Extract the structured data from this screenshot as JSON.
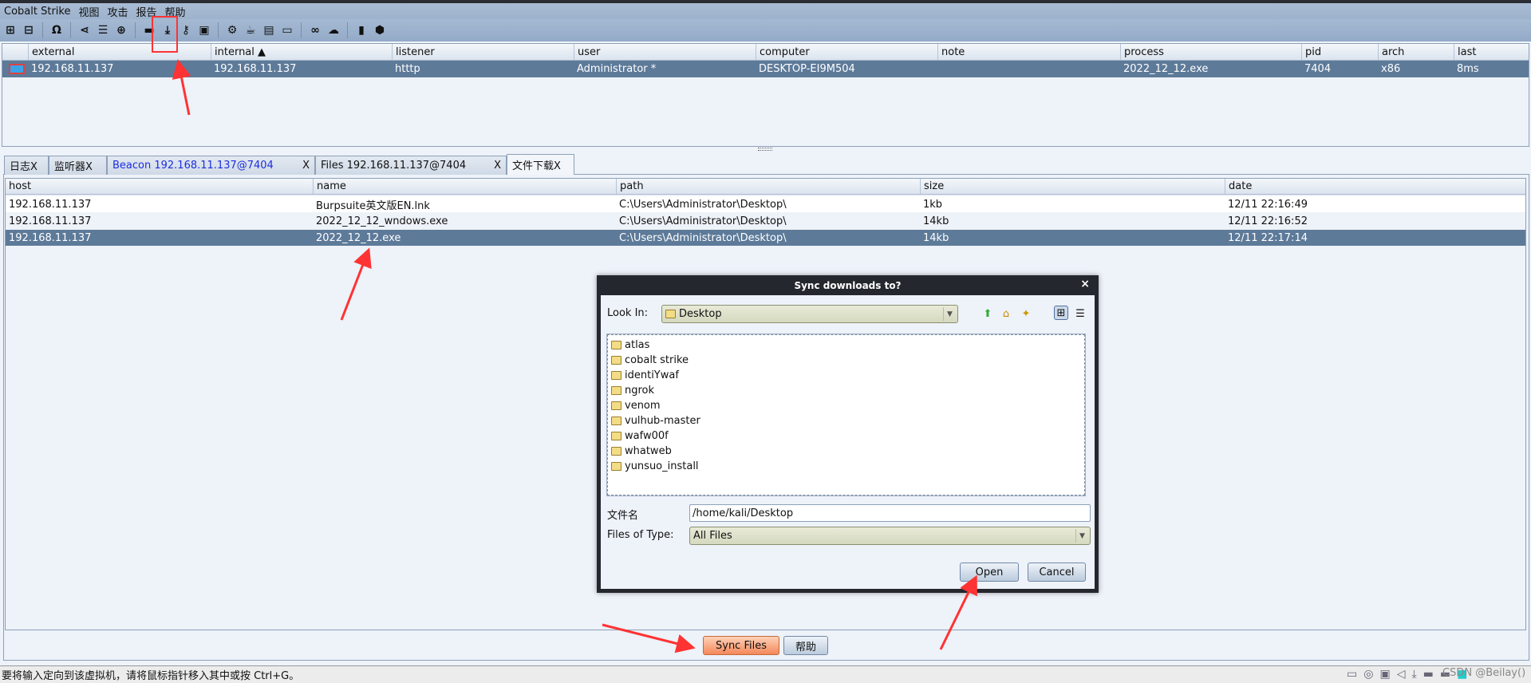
{
  "menu": [
    "Cobalt Strike",
    "视图",
    "攻击",
    "报告",
    "帮助"
  ],
  "toolbar_icons": [
    "plus-icon",
    "minus-icon",
    "headphones-icon",
    "pivot-graph-icon",
    "list-icon",
    "target-icon",
    "credentials-icon",
    "download-icon",
    "key-icon",
    "screenshot-icon",
    "gear-icon",
    "coffee-icon",
    "document-icon",
    "terminal-icon",
    "link-icon",
    "cloud-icon",
    "book-icon",
    "cube-icon"
  ],
  "sessions": {
    "columns": [
      "external",
      "internal ▲",
      "listener",
      "user",
      "computer",
      "note",
      "process",
      "pid",
      "arch",
      "last"
    ],
    "rows": [
      [
        "192.168.11.137",
        "192.168.11.137",
        "htttp",
        "Administrator *",
        "DESKTOP-EI9M504",
        "",
        "2022_12_12.exe",
        "7404",
        "x86",
        "8ms"
      ]
    ]
  },
  "tabs": [
    {
      "label": "日志X"
    },
    {
      "label": "监听器X"
    },
    {
      "label": "Beacon 192.168.11.137@7404",
      "close": "X"
    },
    {
      "label": "Files 192.168.11.137@7404",
      "close": "X"
    },
    {
      "label": "文件下载X"
    }
  ],
  "downloads": {
    "columns": [
      "host",
      "name",
      "path",
      "size",
      "date"
    ],
    "rows": [
      [
        "192.168.11.137",
        "Burpsuite英文版EN.lnk",
        "C:\\Users\\Administrator\\Desktop\\",
        "1kb",
        "12/11 22:16:49"
      ],
      [
        "192.168.11.137",
        "2022_12_12_wndows.exe",
        "C:\\Users\\Administrator\\Desktop\\",
        "14kb",
        "12/11 22:16:52"
      ],
      [
        "192.168.11.137",
        "2022_12_12.exe",
        "C:\\Users\\Administrator\\Desktop\\",
        "14kb",
        "12/11 22:17:14"
      ]
    ],
    "selected_row": 2
  },
  "buttons": {
    "sync": "Sync Files",
    "help": "帮助"
  },
  "dialog": {
    "title": "Sync downloads to?",
    "close": "×",
    "look_in_label": "Look In:",
    "look_in_value": "Desktop",
    "folders": [
      "atlas",
      "cobalt strike",
      "identiYwaf",
      "ngrok",
      "venom",
      "vulhub-master",
      "wafw00f",
      "whatweb",
      "yunsuo_install"
    ],
    "filename_label": "文件名",
    "filename_value": "/home/kali/Desktop",
    "type_label": "Files of Type:",
    "type_value": "All Files",
    "open": "Open",
    "cancel": "Cancel"
  },
  "status": {
    "text": "要将输入定向到该虚拟机，请将鼠标指针移入其中或按 Ctrl+G。",
    "watermark": "CSDN @Beilay()"
  },
  "colors": {
    "selected_row": "#5d7a99",
    "annotation": "#ff3333",
    "sync_button": "#f4875a"
  }
}
